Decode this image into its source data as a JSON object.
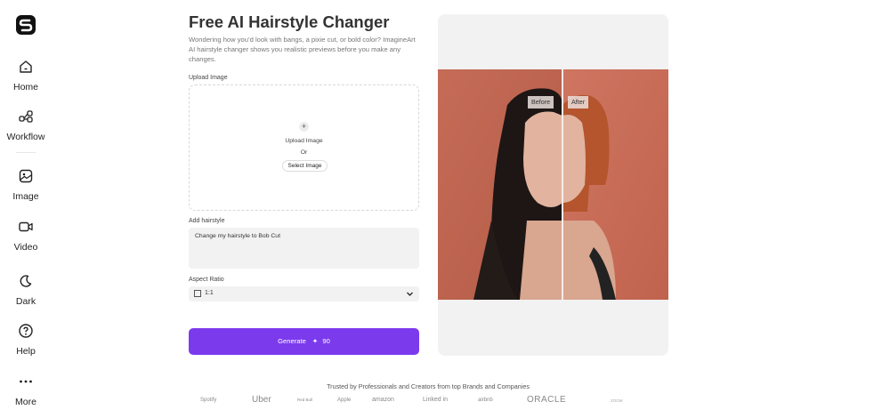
{
  "sidebar": {
    "logo_icon": "brand-s-icon",
    "items": [
      {
        "label": "Home",
        "icon": "home-icon"
      },
      {
        "label": "Workflow",
        "icon": "workflow-icon"
      },
      {
        "label": "Image",
        "icon": "image-icon"
      },
      {
        "label": "Video",
        "icon": "video-icon"
      },
      {
        "label": "Dark",
        "icon": "moon-icon"
      },
      {
        "label": "Help",
        "icon": "help-icon"
      },
      {
        "label": "More",
        "icon": "more-icon"
      }
    ]
  },
  "main": {
    "title": "Free AI Hairstyle Changer",
    "subtitle": "Wondering how you’d look with bangs, a pixie cut, or bold color? ImagineArt AI hairstyle changer shows you realistic previews before you make any changes.",
    "upload": {
      "label": "Upload Image",
      "plus": "+",
      "prompt": "Upload Image",
      "or": "Or",
      "select_button": "Select Image"
    },
    "hairstyle": {
      "label": "Add hairstyle",
      "value": "Change my hairstyle to Bob Cut"
    },
    "aspect": {
      "label": "Aspect Ratio",
      "value": "1:1"
    },
    "generate": {
      "label": "Generate",
      "cost": "90"
    }
  },
  "preview": {
    "before": "Before",
    "after": "After"
  },
  "trusted": {
    "text": "Trusted by Professionals and Creators from top Brands and Companies",
    "brands": [
      "Spotify",
      "Uber",
      "Red Bull",
      "Apple",
      "amazon",
      "Linked in",
      "airbnb",
      "ORACLE",
      "ZOOM"
    ]
  },
  "colors": {
    "accent": "#7c3aed",
    "panel": "#f2f2f2",
    "preview_bg": "#c86a55"
  }
}
